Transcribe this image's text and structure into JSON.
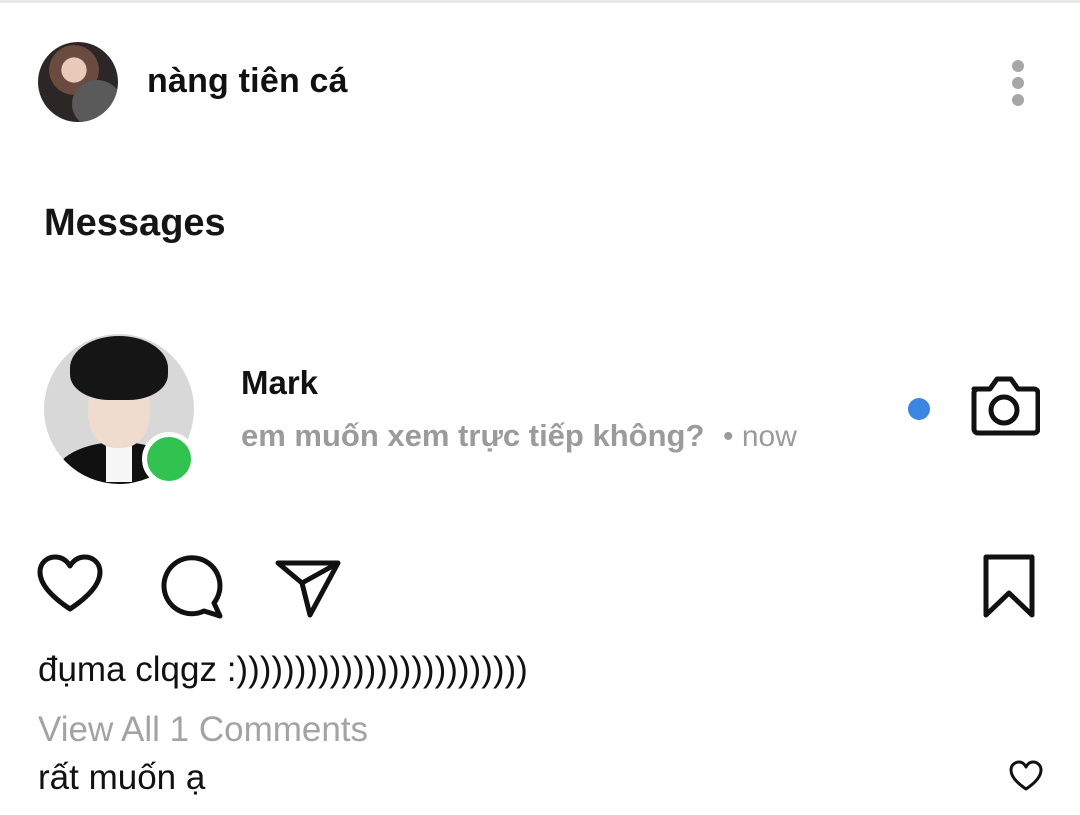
{
  "post": {
    "username": "nàng tiên cá"
  },
  "messages": {
    "title": "Messages",
    "conversation": {
      "name": "Mark",
      "preview": "em muốn xem trực tiếp không?",
      "time": "• now",
      "online": true,
      "unread": true
    }
  },
  "caption": "đụma clqgz :)))))))))))))))))))))))))",
  "view_comments": "View All 1 Comments",
  "comment": "rất muốn ạ",
  "colors": {
    "online": "#31c24f",
    "unread": "#3b86e0",
    "muted": "#9b9b9b"
  },
  "icons": [
    "more-vertical-icon",
    "camera-icon",
    "heart-icon",
    "comment-icon",
    "share-icon",
    "bookmark-icon"
  ]
}
